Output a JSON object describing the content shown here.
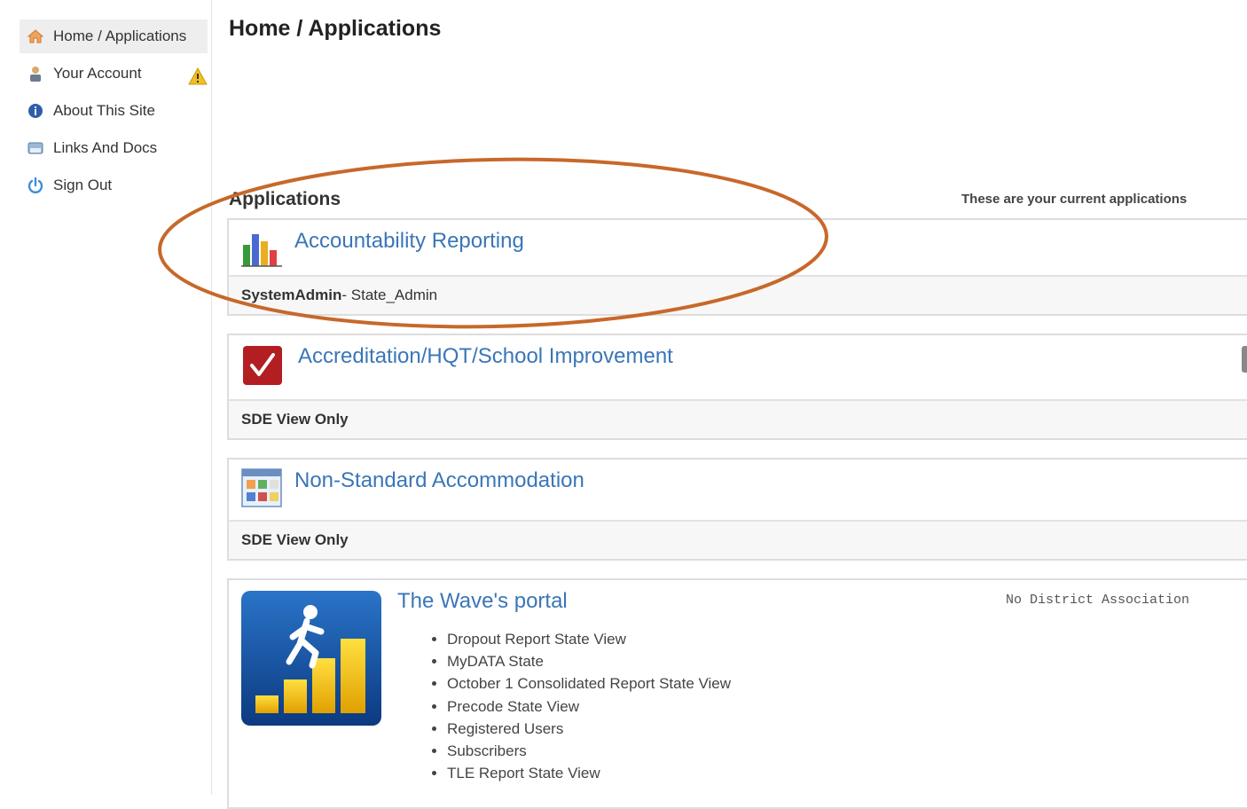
{
  "sidebar": {
    "items": [
      {
        "label": "Home / Applications",
        "icon": "home-icon"
      },
      {
        "label": "Your Account",
        "icon": "user-icon"
      },
      {
        "label": "About This Site",
        "icon": "info-icon"
      },
      {
        "label": "Links And Docs",
        "icon": "links-icon"
      },
      {
        "label": "Sign Out",
        "icon": "power-icon"
      }
    ],
    "warning_icon": "warning-icon"
  },
  "main": {
    "title": "Home / Applications",
    "applications_heading": "Applications",
    "applications_note": "These are your current applications"
  },
  "apps": [
    {
      "name": "Accountability Reporting",
      "role_bold": "SystemAdmin",
      "role_rest": " - State_Admin",
      "icon": "bar-chart-icon"
    },
    {
      "name": "Accreditation/HQT/School Improvement",
      "role_bold": "SDE View Only",
      "role_rest": "",
      "icon": "checkmark-icon"
    },
    {
      "name": "Non-Standard Accommodation",
      "role_bold": "SDE View Only",
      "role_rest": "",
      "icon": "grid-calendar-icon"
    }
  ],
  "wave": {
    "title": "The Wave's portal",
    "status": "No District Association",
    "icon": "stairs-runner-icon",
    "items": [
      "Dropout Report State View",
      "MyDATA State",
      "October 1 Consolidated Report State View",
      "Precode State View",
      "Registered Users",
      "Subscribers",
      "TLE Report State View"
    ]
  },
  "colors": {
    "link": "#3a76b8",
    "highlight": "#c7682a",
    "warning": "#f0c020"
  }
}
